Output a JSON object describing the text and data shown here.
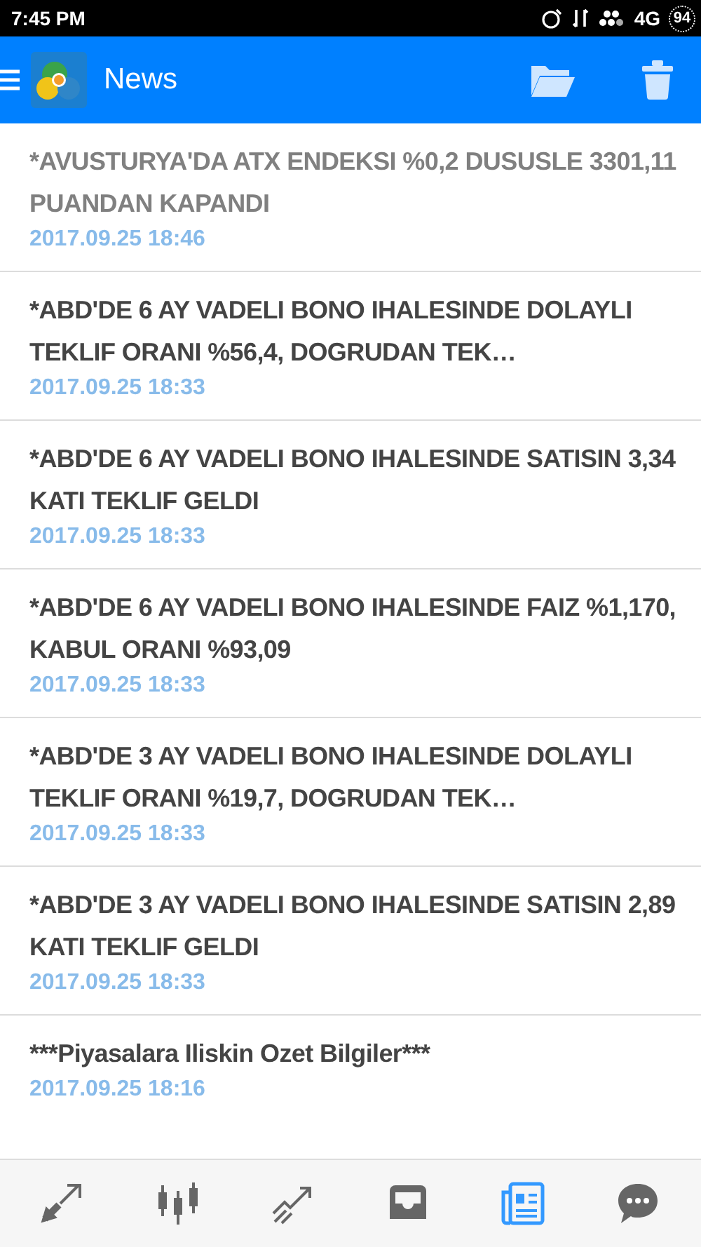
{
  "status_bar": {
    "time": "7:45 PM",
    "network": "4G",
    "battery": "94"
  },
  "app_bar": {
    "title": "News"
  },
  "news": [
    {
      "title": "*AVUSTURYA'DA ATX ENDEKSI %0,2 DUSUSLE 3301,11 PUANDAN KAPANDI",
      "time": "2017.09.25 18:46",
      "read": true
    },
    {
      "title": "*ABD'DE 6 AY VADELI BONO IHALESINDE DOLAYLI TEKLIF ORANI %56,4, DOGRUDAN TEK…",
      "time": "2017.09.25 18:33",
      "read": false
    },
    {
      "title": "*ABD'DE 6 AY VADELI BONO IHALESINDE SATISIN 3,34 KATI TEKLIF GELDI",
      "time": "2017.09.25 18:33",
      "read": false
    },
    {
      "title": "*ABD'DE 6 AY VADELI BONO IHALESINDE FAIZ %1,170, KABUL ORANI %93,09",
      "time": "2017.09.25 18:33",
      "read": false
    },
    {
      "title": "*ABD'DE 3 AY VADELI BONO IHALESINDE DOLAYLI TEKLIF ORANI %19,7, DOGRUDAN TEK…",
      "time": "2017.09.25 18:33",
      "read": false
    },
    {
      "title": "*ABD'DE 3 AY VADELI BONO IHALESINDE SATISIN 2,89 KATI TEKLIF GELDI",
      "time": "2017.09.25 18:33",
      "read": false
    },
    {
      "title": "***Piyasalara Iliskin Ozet Bilgiler***",
      "time": "2017.09.25 18:16",
      "read": false
    }
  ],
  "bottom_nav": [
    {
      "kind": "quotes",
      "selected": false
    },
    {
      "kind": "chart",
      "selected": false
    },
    {
      "kind": "trade",
      "selected": false
    },
    {
      "kind": "history",
      "selected": false
    },
    {
      "kind": "news",
      "selected": true
    },
    {
      "kind": "messages",
      "selected": false
    }
  ]
}
